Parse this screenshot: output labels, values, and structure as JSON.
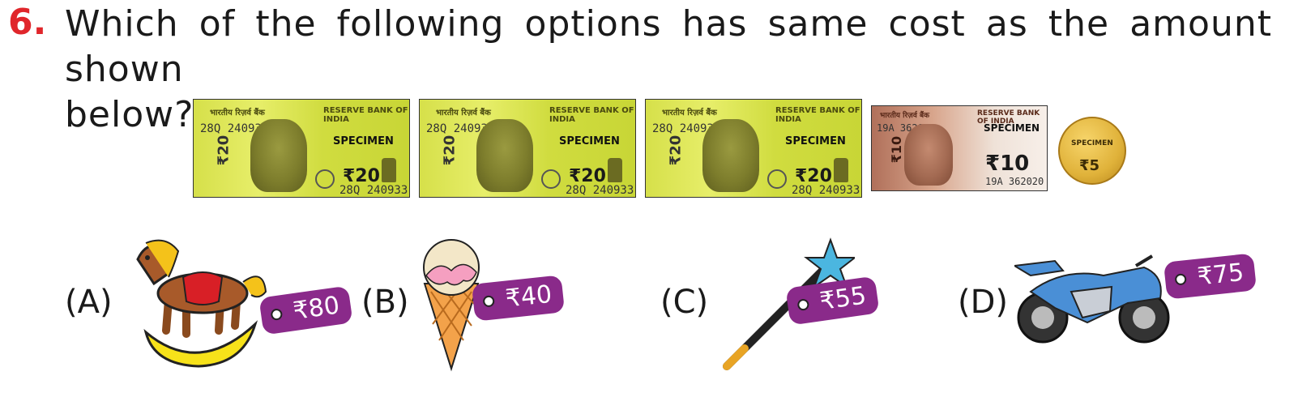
{
  "question": {
    "number": "6.",
    "line1": "Which of the following options has same cost as the amount shown",
    "line2": "below?"
  },
  "money": {
    "note20": {
      "header_hi": "भारतीय रिज़र्व बैंक",
      "header_en": "RESERVE BANK OF INDIA",
      "serial": "28Q 240933",
      "serial_bottom": "28Q 240933",
      "specimen": "SPECIMEN",
      "value": "₹20",
      "side_value": "₹20"
    },
    "note10": {
      "header_hi": "भारतीय रिज़र्व बैंक",
      "header_en": "RESERVE BANK OF INDIA",
      "serial": "19A 362020",
      "serial_bottom": "19A 362020",
      "specimen": "SPECIMEN",
      "value": "₹10",
      "side_value": "₹10"
    },
    "coin": {
      "specimen": "SPECIMEN",
      "value": "₹5"
    }
  },
  "options": [
    {
      "label": "(A)",
      "item": "rocking-horse-icon",
      "price": "₹80"
    },
    {
      "label": "(B)",
      "item": "ice-cream-icon",
      "price": "₹40"
    },
    {
      "label": "(C)",
      "item": "magic-wand-icon",
      "price": "₹55"
    },
    {
      "label": "(D)",
      "item": "motorbike-icon",
      "price": "₹75"
    }
  ],
  "colors": {
    "question_number": "#e0262b",
    "price_tag": "#8a2a8a"
  }
}
